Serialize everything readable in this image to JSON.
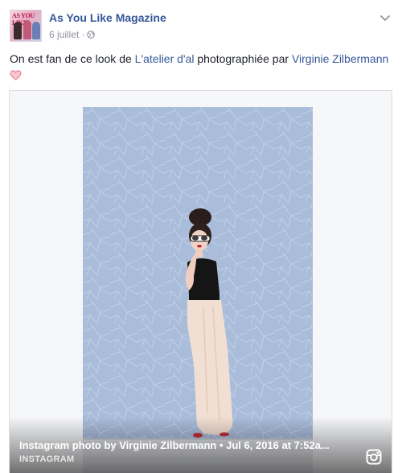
{
  "post": {
    "page_name": "As You Like Magazine",
    "avatar_masthead": "AS YOU LIKE",
    "date": "6 juillet",
    "dot": "·",
    "privacy_icon": "globe-icon",
    "options_icon": "chevron-down-icon"
  },
  "message": {
    "part1": "On est fan de ce look de ",
    "link1": "L'atelier d'al",
    "part2": " photographiée par ",
    "link2": "Virginie Zilbermann",
    "emoji": "heart-icon"
  },
  "attachment": {
    "title": "Instagram photo by Virginie Zilbermann • Jul 6, 2016 at 7:52a...",
    "source": "INSTAGRAM",
    "source_icon": "instagram-icon"
  },
  "colors": {
    "link": "#365899",
    "text": "#1d2129",
    "meta": "#90949c",
    "wall": "#a9bcda",
    "heart": "#e87b8a"
  }
}
